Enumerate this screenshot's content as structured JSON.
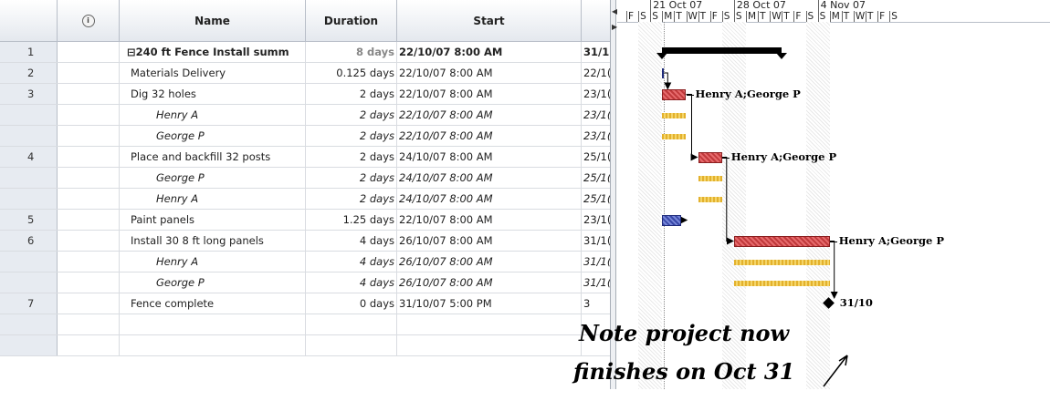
{
  "columns": {
    "indicator_icon": "info-icon",
    "name": "Name",
    "duration": "Duration",
    "start": "Start"
  },
  "rows": [
    {
      "id": "1",
      "name": "⊟240 ft Fence Install summ",
      "duration": "8 days",
      "start": "22/10/07 8:00 AM",
      "finish": "31/1",
      "style": "summary"
    },
    {
      "id": "2",
      "name": "Materials Delivery",
      "duration": "0.125 days",
      "start": "22/10/07 8:00 AM",
      "finish": "22/1(",
      "style": "task"
    },
    {
      "id": "3",
      "name": "Dig 32 holes",
      "duration": "2 days",
      "start": "22/10/07 8:00 AM",
      "finish": "23/1(",
      "style": "task"
    },
    {
      "id": "",
      "name": "Henry A",
      "duration": "2 days",
      "start": "22/10/07 8:00 AM",
      "finish": "23/1(",
      "style": "assignment"
    },
    {
      "id": "",
      "name": "George P",
      "duration": "2 days",
      "start": "22/10/07 8:00 AM",
      "finish": "23/1(",
      "style": "assignment"
    },
    {
      "id": "4",
      "name": "Place and backfill 32 posts",
      "duration": "2 days",
      "start": "24/10/07 8:00 AM",
      "finish": "25/1(",
      "style": "task"
    },
    {
      "id": "",
      "name": "George P",
      "duration": "2 days",
      "start": "24/10/07 8:00 AM",
      "finish": "25/1(",
      "style": "assignment"
    },
    {
      "id": "",
      "name": "Henry A",
      "duration": "2 days",
      "start": "24/10/07 8:00 AM",
      "finish": "25/1(",
      "style": "assignment"
    },
    {
      "id": "5",
      "name": "Paint panels",
      "duration": "1.25 days",
      "start": "22/10/07 8:00 AM",
      "finish": "23/1(",
      "style": "task"
    },
    {
      "id": "6",
      "name": "Install 30 8 ft long panels",
      "duration": "4 days",
      "start": "26/10/07 8:00 AM",
      "finish": "31/1(",
      "style": "task"
    },
    {
      "id": "",
      "name": "Henry A",
      "duration": "4 days",
      "start": "26/10/07 8:00 AM",
      "finish": "31/1(",
      "style": "assignment"
    },
    {
      "id": "",
      "name": "George P",
      "duration": "4 days",
      "start": "26/10/07 8:00 AM",
      "finish": "31/1(",
      "style": "assignment"
    },
    {
      "id": "7",
      "name": "Fence complete",
      "duration": "0 days",
      "start": "31/10/07 5:00 PM",
      "finish": "3",
      "style": "task"
    },
    {
      "id": "",
      "name": "",
      "duration": "",
      "start": "",
      "finish": "",
      "style": "empty"
    },
    {
      "id": "",
      "name": "",
      "duration": "",
      "start": "",
      "finish": "",
      "style": "empty"
    }
  ],
  "gantt": {
    "weeks": [
      "21 Oct 07",
      "28 Oct 07",
      "4 Nov 07"
    ],
    "day_letters": [
      "F",
      "S",
      "S",
      "M",
      "T",
      "W",
      "T",
      "F",
      "S",
      "S",
      "M",
      "T",
      "W",
      "T",
      "F",
      "S",
      "S",
      "M",
      "T",
      "W",
      "T",
      "F",
      "S"
    ],
    "resource_labels": [
      "Henry A;George P",
      "Henry A;George P",
      "Henry A;George P"
    ],
    "milestone_label": "31/10",
    "note_line1": "Note project now",
    "note_line2": "finishes on Oct 31"
  },
  "colors": {
    "task_bar": "#c0393b",
    "assignment_bar": "#e3b12c",
    "paint_bar": "#3948a8",
    "summary_bar": "#000000"
  }
}
